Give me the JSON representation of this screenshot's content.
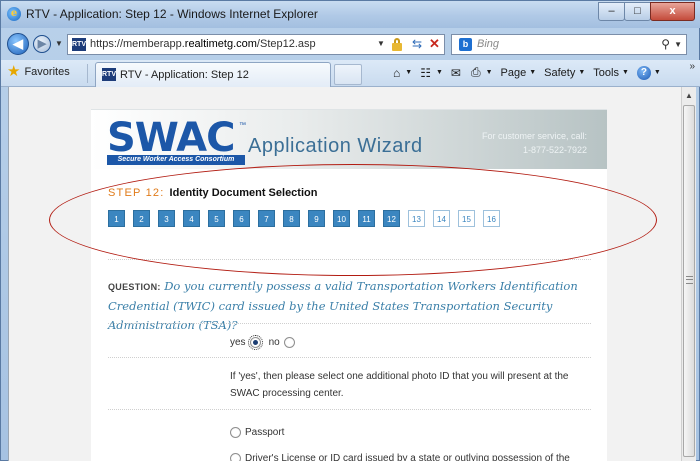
{
  "window": {
    "title": "RTV - Application: Step 12 - Windows Internet Explorer",
    "buttons": {
      "minimize": "–",
      "maximize": "□",
      "close": "x"
    }
  },
  "address_bar": {
    "url_prefix": "https://memberapp.",
    "url_domain": "realtimetg.com",
    "url_path": "/Step12.asp",
    "favicon_text": "RTV"
  },
  "search": {
    "placeholder": "Bing"
  },
  "favorites": {
    "label": "Favorites"
  },
  "tab": {
    "label": "RTV - Application: Step 12"
  },
  "command_bar": {
    "page": "Page",
    "safety": "Safety",
    "tools": "Tools"
  },
  "header": {
    "logo_text": "SWAC",
    "logo_tm": "™",
    "logo_sub": "Secure Worker Access Consortium",
    "wizard_title": "Application Wizard",
    "customer_service_line1": "For customer service, call:",
    "customer_service_line2": "1-877-522-7922"
  },
  "step": {
    "number_label": "STEP 12:",
    "title": "Identity Document Selection",
    "buttons": [
      "1",
      "2",
      "3",
      "4",
      "5",
      "6",
      "7",
      "8",
      "9",
      "10",
      "11",
      "12",
      "13",
      "14",
      "15",
      "16"
    ],
    "current": 12
  },
  "question": {
    "label": "QUESTION:",
    "text": "Do you currently possess a valid Transportation Workers Identification Credential (TWIC) card issued by the United States Transportation Security Administration (TSA)?"
  },
  "answers": {
    "yes": "yes",
    "no": "no",
    "selected": "yes"
  },
  "instructions": "If 'yes', then please select one additional photo ID that you will present at the SWAC processing center.",
  "options": [
    "Passport",
    "Driver's License or ID card issued by a state or outlying possession of the"
  ]
}
